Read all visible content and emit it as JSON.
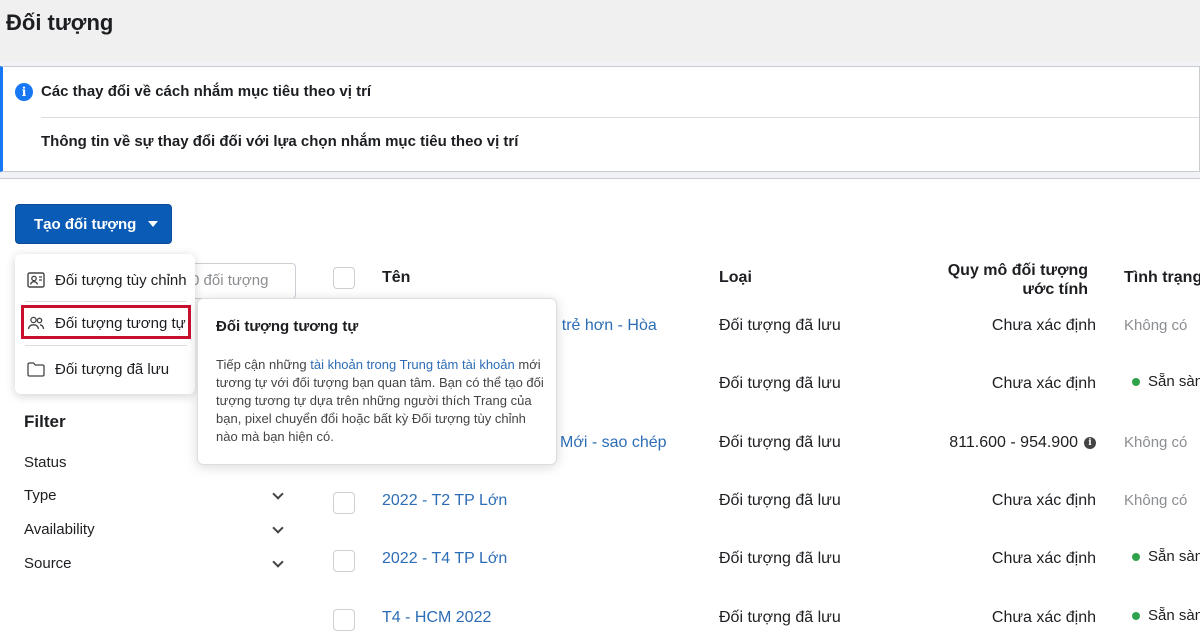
{
  "page": {
    "title": "Đối tượng"
  },
  "notice": {
    "title": "Các thay đổi về cách nhắm mục tiêu theo vị trí",
    "subtitle": "Thông tin về sự thay đổi đối với lựa chọn nhắm mục tiêu theo vị trí",
    "icon": "info-icon"
  },
  "toolbar": {
    "create_label": "Tạo đối tượng"
  },
  "search": {
    "placeholder": "0 đối tượng"
  },
  "dropdown": {
    "items": [
      {
        "label": "Đối tượng tùy chỉnh",
        "icon": "custom-audience-icon"
      },
      {
        "label": "Đối tượng tương tự",
        "icon": "lookalike-audience-icon"
      },
      {
        "label": "Đối tượng đã lưu",
        "icon": "folder-icon"
      }
    ]
  },
  "tooltip": {
    "title": "Đối tượng tương tự",
    "body_prefix": "Tiếp cận những ",
    "body_link": "tài khoản trong Trung tâm tài khoản",
    "body_suffix": " mới tương tự với đối tượng bạn quan tâm. Bạn có thể tạo đối tượng tương tự dựa trên những người thích Trang của bạn, pixel chuyển đổi hoặc bất kỳ Đối tượng tùy chỉnh nào mà bạn hiện có."
  },
  "filter": {
    "title": "Filter",
    "items": [
      "Status",
      "Type",
      "Availability",
      "Source"
    ]
  },
  "table": {
    "headers": {
      "name": "Tên",
      "type": "Loại",
      "size": "Quy mô đối tượng ước tính",
      "status": "Tình trạng"
    },
    "rows": [
      {
        "name": "- trẻ hơn - Hòa",
        "type": "Đối tượng đã lưu",
        "size": "Chưa xác định",
        "status": "Không có"
      },
      {
        "name": "",
        "type": "Đối tượng đã lưu",
        "size": "Chưa xác định",
        "status": "Sẵn sàng"
      },
      {
        "name": "Mới - sao chép",
        "type": "Đối tượng đã lưu",
        "size": "811.600 - 954.900",
        "status": "Không có"
      },
      {
        "name": "2022 - T2 TP Lớn",
        "type": "Đối tượng đã lưu",
        "size": "Chưa xác định",
        "status": "Không có"
      },
      {
        "name": "2022 - T4 TP Lớn",
        "type": "Đối tượng đã lưu",
        "size": "Chưa xác định",
        "status": "Sẵn sàng"
      },
      {
        "name": "T4 - HCM 2022",
        "type": "Đối tượng đã lưu",
        "size": "Chưa xác định",
        "status": "Sẵn sàng"
      }
    ]
  },
  "colors": {
    "primary": "#0a5bb5",
    "link": "#2d6db5",
    "ready": "#31a24c",
    "highlight": "#c8102e"
  }
}
